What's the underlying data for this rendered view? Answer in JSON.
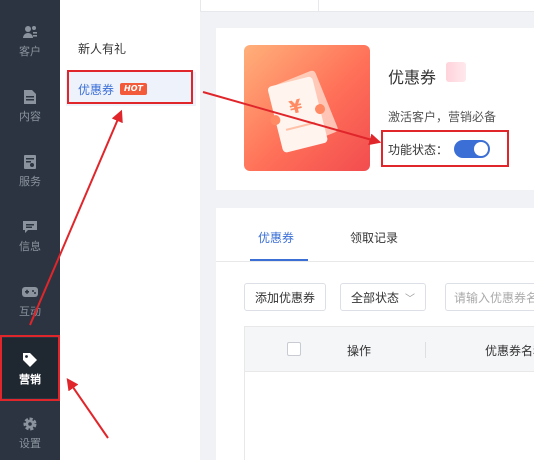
{
  "sidebar": {
    "items": [
      {
        "label": "客户",
        "icon": "customers-icon"
      },
      {
        "label": "内容",
        "icon": "content-icon"
      },
      {
        "label": "服务",
        "icon": "service-icon"
      },
      {
        "label": "信息",
        "icon": "message-icon"
      },
      {
        "label": "互动",
        "icon": "gamepad-icon"
      },
      {
        "label": "营销",
        "icon": "tag-icon",
        "active": true
      },
      {
        "label": "设置",
        "icon": "gear-icon"
      }
    ]
  },
  "subnav": {
    "items": [
      {
        "label": "新人有礼"
      },
      {
        "label": "优惠券",
        "badge": "HOT",
        "active": true
      }
    ]
  },
  "feature": {
    "title": "优惠券",
    "description": "激活客户，营销必备",
    "status_label": "功能状态：",
    "enabled": true
  },
  "tabs": [
    {
      "label": "优惠券",
      "active": true
    },
    {
      "label": "领取记录",
      "active": false
    }
  ],
  "toolbar": {
    "add_label": "添加优惠券",
    "status_select": "全部状态",
    "search_placeholder": "请输入优惠券名称"
  },
  "table": {
    "columns": [
      "操作",
      "优惠券名称"
    ]
  },
  "colors": {
    "accent": "#3b6fd6",
    "annotation": "#e0262b",
    "hot_badge": "#f25a3a"
  }
}
